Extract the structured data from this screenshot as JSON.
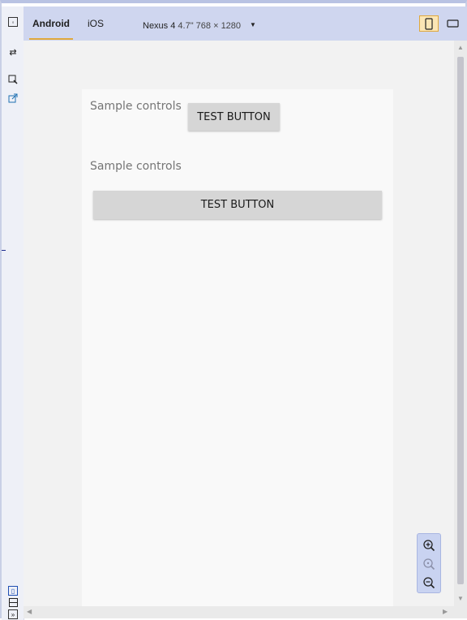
{
  "toolbar": {
    "tabs": [
      {
        "label": "Android",
        "active": true
      },
      {
        "label": "iOS",
        "active": false
      }
    ],
    "device": {
      "name": "Nexus 4",
      "specs": "4.7\" 768 × 1280"
    }
  },
  "preview": {
    "row1": {
      "label": "Sample controls",
      "button": "TEST BUTTON"
    },
    "row2": {
      "label": "Sample controls",
      "button": "TEST BUTTON"
    }
  },
  "zoom_controls": [
    "zoom-in-icon",
    "zoom-reset-icon",
    "zoom-out-icon"
  ],
  "colors": {
    "accent": "#e0a83c",
    "toolbar": "#cfd6ef",
    "button": "#d6d6d6",
    "label": "#757575"
  }
}
